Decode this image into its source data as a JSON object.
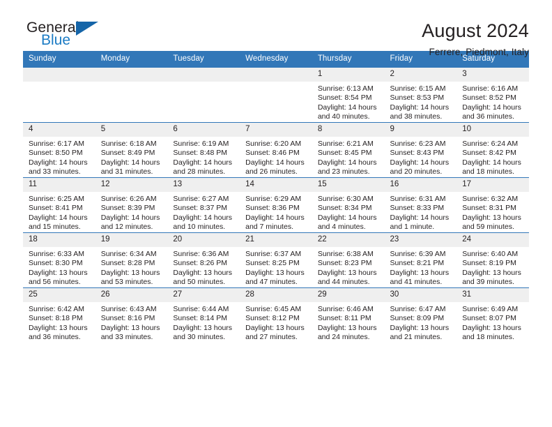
{
  "brand": {
    "name_top": "General",
    "name_bottom": "Blue",
    "accent_color": "#1b7bc4",
    "triangle_color": "#1565a8"
  },
  "header": {
    "title": "August 2024",
    "subtitle": "Ferrere, Piedmont, Italy"
  },
  "theme": {
    "header_row_bg": "#3277b8",
    "daynum_bg": "#efefef",
    "text_color": "#231f20"
  },
  "weekday_headers": [
    "Sunday",
    "Monday",
    "Tuesday",
    "Wednesday",
    "Thursday",
    "Friday",
    "Saturday"
  ],
  "labels": {
    "sunrise_prefix": "Sunrise:",
    "sunset_prefix": "Sunset:",
    "daylight_prefix": "Daylight:"
  },
  "weeks": [
    [
      {
        "day": "",
        "empty": true
      },
      {
        "day": "",
        "empty": true
      },
      {
        "day": "",
        "empty": true
      },
      {
        "day": "",
        "empty": true
      },
      {
        "day": "1",
        "sunrise": "Sunrise: 6:13 AM",
        "sunset": "Sunset: 8:54 PM",
        "daylight": "Daylight: 14 hours and 40 minutes."
      },
      {
        "day": "2",
        "sunrise": "Sunrise: 6:15 AM",
        "sunset": "Sunset: 8:53 PM",
        "daylight": "Daylight: 14 hours and 38 minutes."
      },
      {
        "day": "3",
        "sunrise": "Sunrise: 6:16 AM",
        "sunset": "Sunset: 8:52 PM",
        "daylight": "Daylight: 14 hours and 36 minutes."
      }
    ],
    [
      {
        "day": "4",
        "sunrise": "Sunrise: 6:17 AM",
        "sunset": "Sunset: 8:50 PM",
        "daylight": "Daylight: 14 hours and 33 minutes."
      },
      {
        "day": "5",
        "sunrise": "Sunrise: 6:18 AM",
        "sunset": "Sunset: 8:49 PM",
        "daylight": "Daylight: 14 hours and 31 minutes."
      },
      {
        "day": "6",
        "sunrise": "Sunrise: 6:19 AM",
        "sunset": "Sunset: 8:48 PM",
        "daylight": "Daylight: 14 hours and 28 minutes."
      },
      {
        "day": "7",
        "sunrise": "Sunrise: 6:20 AM",
        "sunset": "Sunset: 8:46 PM",
        "daylight": "Daylight: 14 hours and 26 minutes."
      },
      {
        "day": "8",
        "sunrise": "Sunrise: 6:21 AM",
        "sunset": "Sunset: 8:45 PM",
        "daylight": "Daylight: 14 hours and 23 minutes."
      },
      {
        "day": "9",
        "sunrise": "Sunrise: 6:23 AM",
        "sunset": "Sunset: 8:43 PM",
        "daylight": "Daylight: 14 hours and 20 minutes."
      },
      {
        "day": "10",
        "sunrise": "Sunrise: 6:24 AM",
        "sunset": "Sunset: 8:42 PM",
        "daylight": "Daylight: 14 hours and 18 minutes."
      }
    ],
    [
      {
        "day": "11",
        "sunrise": "Sunrise: 6:25 AM",
        "sunset": "Sunset: 8:41 PM",
        "daylight": "Daylight: 14 hours and 15 minutes."
      },
      {
        "day": "12",
        "sunrise": "Sunrise: 6:26 AM",
        "sunset": "Sunset: 8:39 PM",
        "daylight": "Daylight: 14 hours and 12 minutes."
      },
      {
        "day": "13",
        "sunrise": "Sunrise: 6:27 AM",
        "sunset": "Sunset: 8:37 PM",
        "daylight": "Daylight: 14 hours and 10 minutes."
      },
      {
        "day": "14",
        "sunrise": "Sunrise: 6:29 AM",
        "sunset": "Sunset: 8:36 PM",
        "daylight": "Daylight: 14 hours and 7 minutes."
      },
      {
        "day": "15",
        "sunrise": "Sunrise: 6:30 AM",
        "sunset": "Sunset: 8:34 PM",
        "daylight": "Daylight: 14 hours and 4 minutes."
      },
      {
        "day": "16",
        "sunrise": "Sunrise: 6:31 AM",
        "sunset": "Sunset: 8:33 PM",
        "daylight": "Daylight: 14 hours and 1 minute."
      },
      {
        "day": "17",
        "sunrise": "Sunrise: 6:32 AM",
        "sunset": "Sunset: 8:31 PM",
        "daylight": "Daylight: 13 hours and 59 minutes."
      }
    ],
    [
      {
        "day": "18",
        "sunrise": "Sunrise: 6:33 AM",
        "sunset": "Sunset: 8:30 PM",
        "daylight": "Daylight: 13 hours and 56 minutes."
      },
      {
        "day": "19",
        "sunrise": "Sunrise: 6:34 AM",
        "sunset": "Sunset: 8:28 PM",
        "daylight": "Daylight: 13 hours and 53 minutes."
      },
      {
        "day": "20",
        "sunrise": "Sunrise: 6:36 AM",
        "sunset": "Sunset: 8:26 PM",
        "daylight": "Daylight: 13 hours and 50 minutes."
      },
      {
        "day": "21",
        "sunrise": "Sunrise: 6:37 AM",
        "sunset": "Sunset: 8:25 PM",
        "daylight": "Daylight: 13 hours and 47 minutes."
      },
      {
        "day": "22",
        "sunrise": "Sunrise: 6:38 AM",
        "sunset": "Sunset: 8:23 PM",
        "daylight": "Daylight: 13 hours and 44 minutes."
      },
      {
        "day": "23",
        "sunrise": "Sunrise: 6:39 AM",
        "sunset": "Sunset: 8:21 PM",
        "daylight": "Daylight: 13 hours and 41 minutes."
      },
      {
        "day": "24",
        "sunrise": "Sunrise: 6:40 AM",
        "sunset": "Sunset: 8:19 PM",
        "daylight": "Daylight: 13 hours and 39 minutes."
      }
    ],
    [
      {
        "day": "25",
        "sunrise": "Sunrise: 6:42 AM",
        "sunset": "Sunset: 8:18 PM",
        "daylight": "Daylight: 13 hours and 36 minutes."
      },
      {
        "day": "26",
        "sunrise": "Sunrise: 6:43 AM",
        "sunset": "Sunset: 8:16 PM",
        "daylight": "Daylight: 13 hours and 33 minutes."
      },
      {
        "day": "27",
        "sunrise": "Sunrise: 6:44 AM",
        "sunset": "Sunset: 8:14 PM",
        "daylight": "Daylight: 13 hours and 30 minutes."
      },
      {
        "day": "28",
        "sunrise": "Sunrise: 6:45 AM",
        "sunset": "Sunset: 8:12 PM",
        "daylight": "Daylight: 13 hours and 27 minutes."
      },
      {
        "day": "29",
        "sunrise": "Sunrise: 6:46 AM",
        "sunset": "Sunset: 8:11 PM",
        "daylight": "Daylight: 13 hours and 24 minutes."
      },
      {
        "day": "30",
        "sunrise": "Sunrise: 6:47 AM",
        "sunset": "Sunset: 8:09 PM",
        "daylight": "Daylight: 13 hours and 21 minutes."
      },
      {
        "day": "31",
        "sunrise": "Sunrise: 6:49 AM",
        "sunset": "Sunset: 8:07 PM",
        "daylight": "Daylight: 13 hours and 18 minutes."
      }
    ]
  ]
}
